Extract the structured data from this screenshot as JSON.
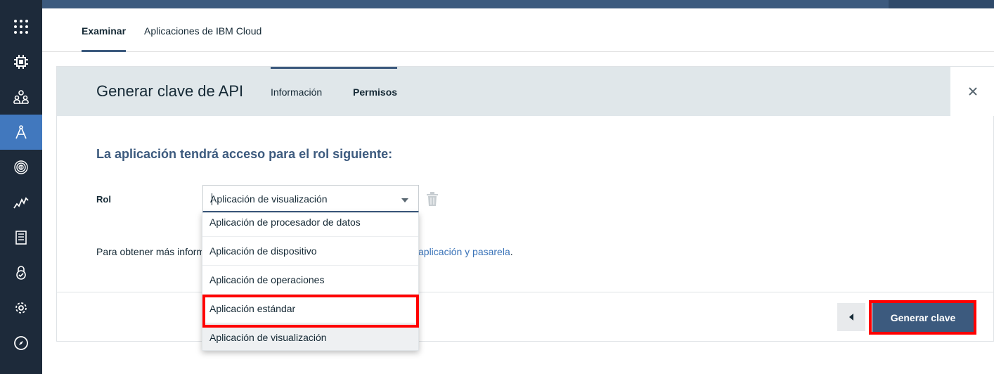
{
  "sidebar": {
    "items": [
      {
        "icon": "apps-grid-icon"
      },
      {
        "icon": "chip-icon"
      },
      {
        "icon": "members-icon"
      },
      {
        "icon": "compass-tool-icon",
        "active": true
      },
      {
        "icon": "fingerprint-icon"
      },
      {
        "icon": "usage-chart-icon"
      },
      {
        "icon": "document-icon"
      },
      {
        "icon": "security-lock-icon"
      },
      {
        "icon": "gear-icon"
      },
      {
        "icon": "compass-icon"
      }
    ]
  },
  "main_tabs": [
    {
      "label": "Examinar",
      "active": true
    },
    {
      "label": "Aplicaciones de IBM Cloud",
      "active": false
    }
  ],
  "panel": {
    "title": "Generar clave de API",
    "tabs": [
      {
        "label": "Información",
        "active": false
      },
      {
        "label": "Permisos",
        "active": true
      }
    ],
    "close_icon": "close-icon",
    "heading": "La aplicación tendrá acceso para el rol siguiente:",
    "role_label": "Rol",
    "role_select": {
      "value": "Aplicación de visualización",
      "options": [
        "Aplicación de procesador de datos",
        "Aplicación de dispositivo",
        "Aplicación de operaciones",
        "Aplicación estándar",
        "Aplicación de visualización"
      ]
    },
    "info_text": "Para obtener más inform",
    "info_link": "aplicación y pasarela",
    "info_suffix": ".",
    "back_label": "◂",
    "generate_label": "Generar clave"
  },
  "colors": {
    "accent": "#3c5a7e",
    "sidebar_bg": "#1d2a3a",
    "active_nav": "#4178be",
    "highlight": "#ff0000",
    "link": "#3a73b8"
  }
}
